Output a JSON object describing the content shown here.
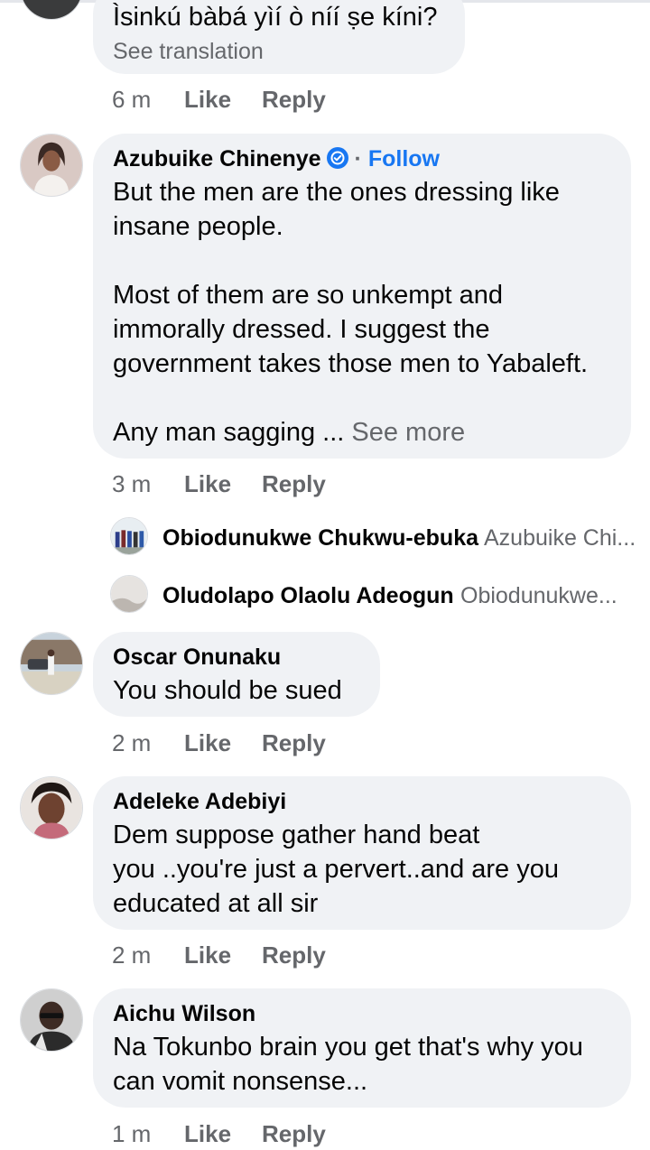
{
  "comments": [
    {
      "body_lines": [
        "Ìsinkú bàbá yìí ò níí ṣe kíni?"
      ],
      "see_translation": "See translation",
      "time": "6 m",
      "like": "Like",
      "reply": "Reply"
    },
    {
      "name": "Azubuike Chinenye",
      "separator": "·",
      "follow": "Follow",
      "body_lines": [
        "But the men are the ones dressing like",
        "insane people.",
        "Most of them are so unkempt and",
        "immorally dressed. I suggest the",
        "government takes those men to Yabaleft.",
        "Any man sagging ..."
      ],
      "see_more": "See more",
      "time": "3 m",
      "like": "Like",
      "reply": "Reply",
      "replies": [
        {
          "name": "Obiodunukwe Chukwu-ebuka",
          "text": "Azubuike Chi..."
        },
        {
          "name": "Oludolapo Olaolu Adeogun",
          "text": "Obiodunukwe..."
        }
      ]
    },
    {
      "name": "Oscar Onunaku",
      "body_lines": [
        "You should be sued"
      ],
      "time": "2 m",
      "like": "Like",
      "reply": "Reply"
    },
    {
      "name": "Adeleke Adebiyi",
      "body_lines": [
        "Dem suppose gather hand beat",
        "you ..you're just a pervert..and are you",
        "educated at all sir"
      ],
      "time": "2 m",
      "like": "Like",
      "reply": "Reply"
    },
    {
      "name": "Aichu Wilson",
      "body_lines": [
        "Na Tokunbo brain you get that's why you",
        "can vomit nonsense..."
      ],
      "time": "1 m",
      "like": "Like",
      "reply": "Reply"
    }
  ],
  "colors": {
    "bubble": "#f0f2f5",
    "secondary_text": "#65676b",
    "follow": "#1877f2",
    "verified": "#1877f2"
  }
}
